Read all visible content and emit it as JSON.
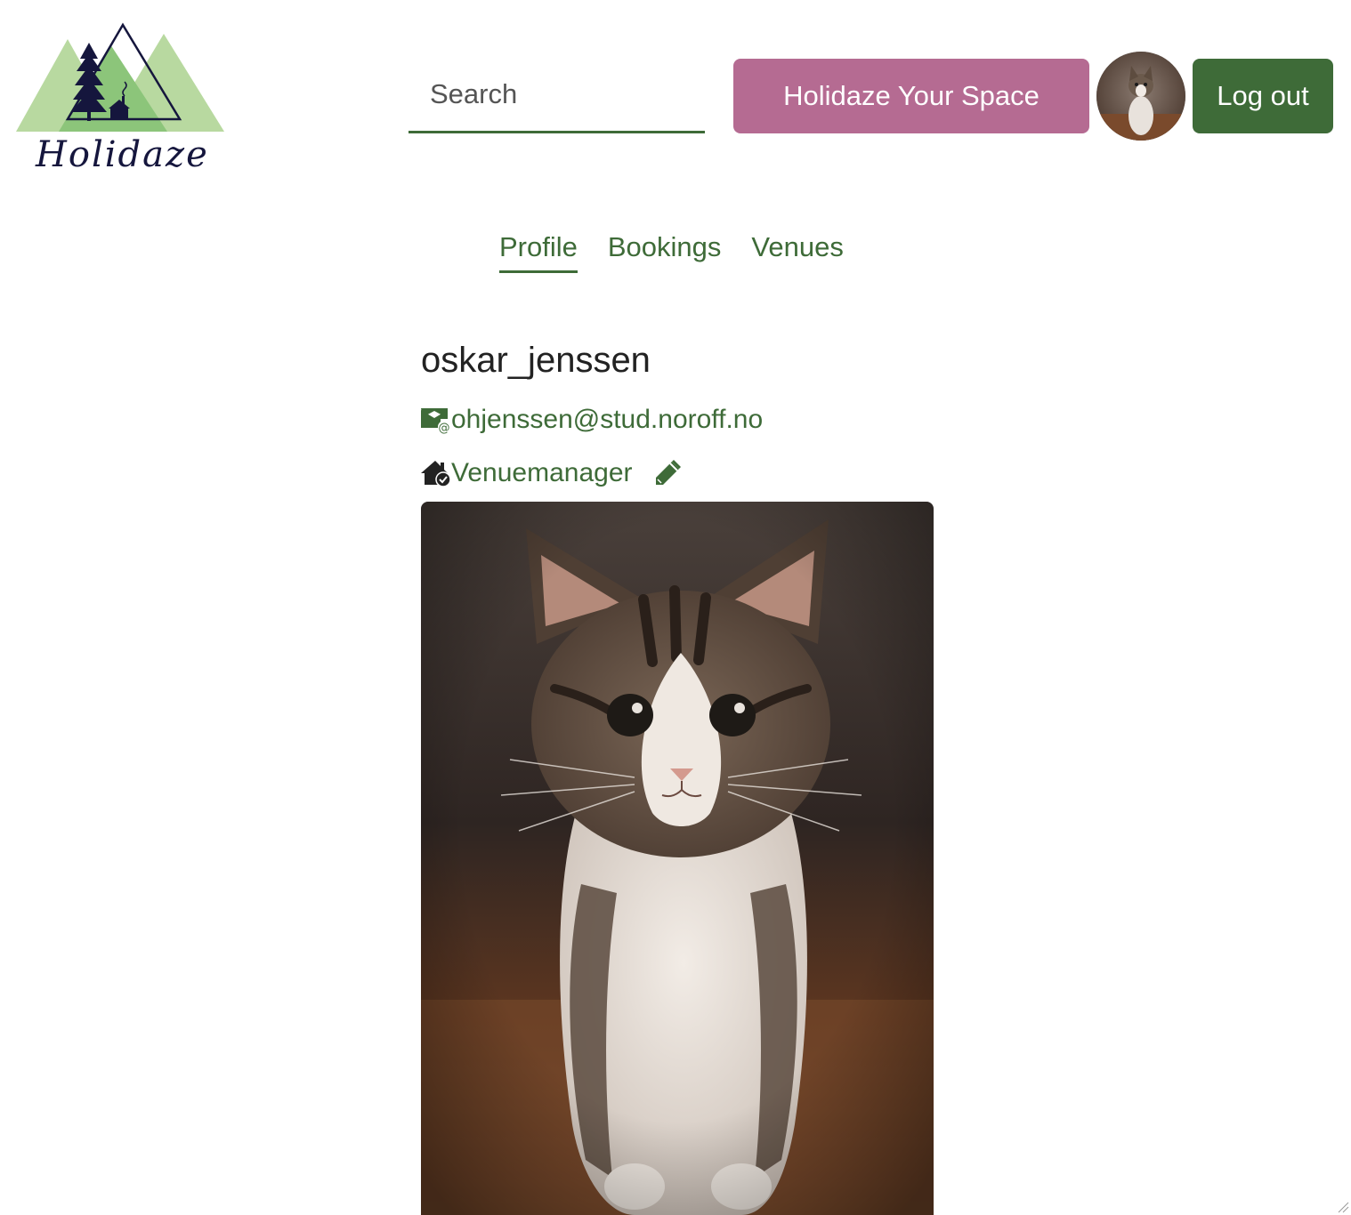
{
  "brand": {
    "logo_text": "Holidaze",
    "colors": {
      "primary_green": "#3e6b38",
      "pink": "#b56b92",
      "logo_light_green": "#b8d9a0",
      "logo_mid_green": "#8cc57a",
      "logo_navy": "#15163d"
    }
  },
  "header": {
    "search": {
      "placeholder": "Search",
      "value": ""
    },
    "space_button_label": "Holidaze Your Space",
    "avatar_icon": "kitten-avatar",
    "logout_label": "Log out"
  },
  "tabs": [
    {
      "label": "Profile",
      "active": true
    },
    {
      "label": "Bookings",
      "active": false
    },
    {
      "label": "Venues",
      "active": false
    }
  ],
  "profile": {
    "username": "oskar_jenssen",
    "email": "ohjenssen@stud.noroff.no",
    "email_icon": "envelope-at-icon",
    "role": "Venuemanager",
    "role_icon": "house-check-icon",
    "edit_icon": "pencil-icon",
    "image_subject": "kitten-photo"
  }
}
